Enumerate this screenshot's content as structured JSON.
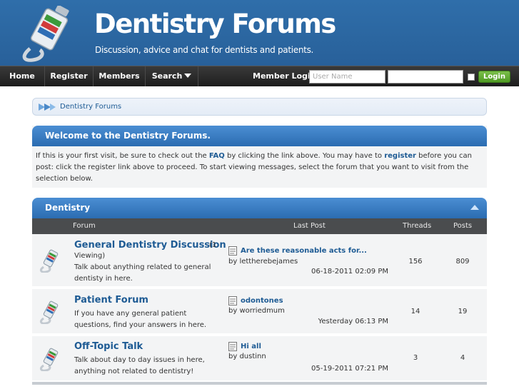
{
  "header": {
    "title": "Dentistry Forums",
    "tagline": "Discussion, advice and chat for dentists and patients."
  },
  "nav": {
    "home": "Home",
    "register": "Register",
    "members": "Members",
    "search": "Search",
    "member_login_label": "Member Login:",
    "username_placeholder": "User Name",
    "login_button": "Login"
  },
  "breadcrumb": {
    "label": "Dentistry Forums"
  },
  "welcome": {
    "title": "Welcome to the Dentistry Forums.",
    "text_1": "If this is your first visit, be sure to check out the ",
    "faq": "FAQ",
    "text_2": " by clicking the link above. You may have to ",
    "register": "register",
    "text_3": " before you can post: click the register link above to proceed. To start viewing messages, select the forum that you want to visit from the selection below."
  },
  "forum_block": {
    "title": "Dentistry",
    "columns": {
      "forum": "Forum",
      "last_post": "Last Post",
      "threads": "Threads",
      "posts": "Posts"
    },
    "rows": [
      {
        "title": "General Dentistry Discussion",
        "viewing": "(1 Viewing)",
        "description": "Talk about anything related to general dentisty in here.",
        "last_post_title": "Are these reasonable acts for...",
        "last_post_by": "by lettherebejames",
        "last_post_date": "06-18-2011 02:09 PM",
        "threads": "156",
        "posts": "809"
      },
      {
        "title": "Patient Forum",
        "viewing": "",
        "description": "If you have any general patient questions, find your answers in here.",
        "last_post_title": "odontones",
        "last_post_by": "by worriedmum",
        "last_post_date": "Yesterday 06:13 PM",
        "threads": "14",
        "posts": "19"
      },
      {
        "title": "Off-Topic Talk",
        "viewing": "",
        "description": "Talk about day to day issues in here, anything not related to dentistry!",
        "last_post_title": "Hi all",
        "last_post_by": "by dustinn",
        "last_post_date": "05-19-2011 07:21 PM",
        "threads": "3",
        "posts": "4"
      }
    ]
  },
  "colors": {
    "header_blue": "#2b66a0",
    "link_blue": "#1e5b94",
    "login_green": "#4e9a23"
  }
}
